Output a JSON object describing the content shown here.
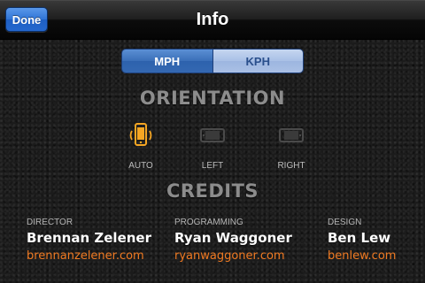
{
  "navbar": {
    "title": "Info",
    "done_label": "Done"
  },
  "speed_units": {
    "options": [
      {
        "label": "MPH",
        "selected": true
      },
      {
        "label": "KPH",
        "selected": false
      }
    ]
  },
  "orientation": {
    "heading": "ORIENTATION",
    "options": [
      {
        "label": "AUTO",
        "icon": "phone-rotate-icon",
        "selected": true
      },
      {
        "label": "LEFT",
        "icon": "phone-landscape-left-icon",
        "selected": false
      },
      {
        "label": "RIGHT",
        "icon": "phone-landscape-right-icon",
        "selected": false
      }
    ]
  },
  "credits": {
    "heading": "CREDITS",
    "people": [
      {
        "role": "DIRECTOR",
        "name": "Brennan Zelener",
        "link": "brennanzelener.com"
      },
      {
        "role": "PROGRAMMING",
        "name": "Ryan Waggoner",
        "link": "ryanwaggoner.com"
      },
      {
        "role": "DESIGN",
        "name": "Ben Lew",
        "link": "benlew.com"
      }
    ]
  },
  "colors": {
    "accent": "#f5a623",
    "link": "#f07a22",
    "heading": "#8c8c8c",
    "segment_on": "#3a6fb8"
  }
}
